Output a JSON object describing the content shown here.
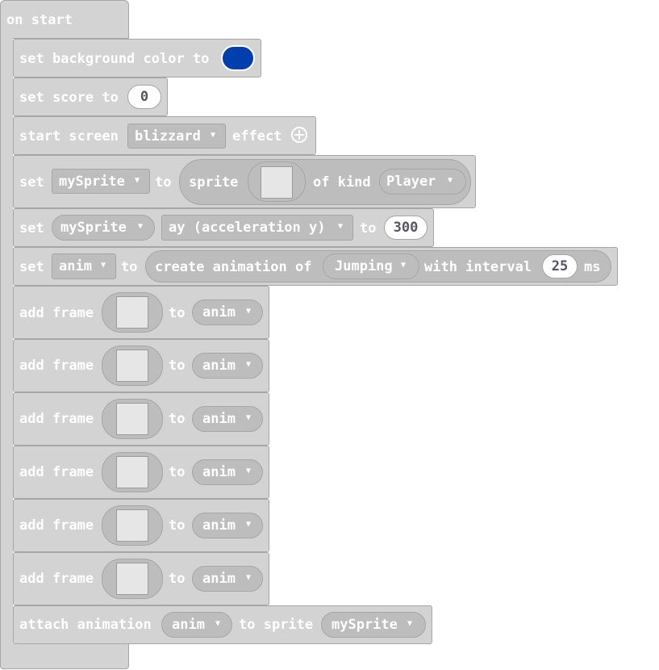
{
  "hat": {
    "label": "on start"
  },
  "bg": {
    "set_label": "set background color to",
    "color": "#003fad"
  },
  "score": {
    "label": "set score to",
    "value": "0"
  },
  "effect": {
    "label_a": "start screen",
    "dropdown": "blizzard",
    "label_b": "effect"
  },
  "create": {
    "set": "set",
    "var": "mySprite",
    "to": "to",
    "sprite": "sprite",
    "of_kind": "of kind",
    "kind": "Player"
  },
  "accel": {
    "set": "set",
    "var": "mySprite",
    "prop": "ay (acceleration y)",
    "to": "to",
    "value": "300"
  },
  "anim": {
    "set": "set",
    "var": "anim",
    "to": "to",
    "create": "create animation of",
    "type": "Jumping",
    "interval": "with interval",
    "value": "25",
    "unit": "ms"
  },
  "frames": [
    {
      "label": "add frame",
      "to": "to",
      "var": "anim"
    },
    {
      "label": "add frame",
      "to": "to",
      "var": "anim"
    },
    {
      "label": "add frame",
      "to": "to",
      "var": "anim"
    },
    {
      "label": "add frame",
      "to": "to",
      "var": "anim"
    },
    {
      "label": "add frame",
      "to": "to",
      "var": "anim"
    },
    {
      "label": "add frame",
      "to": "to",
      "var": "anim"
    }
  ],
  "attach": {
    "label": "attach animation",
    "var": "anim",
    "to": "to sprite",
    "sprite": "mySprite"
  }
}
